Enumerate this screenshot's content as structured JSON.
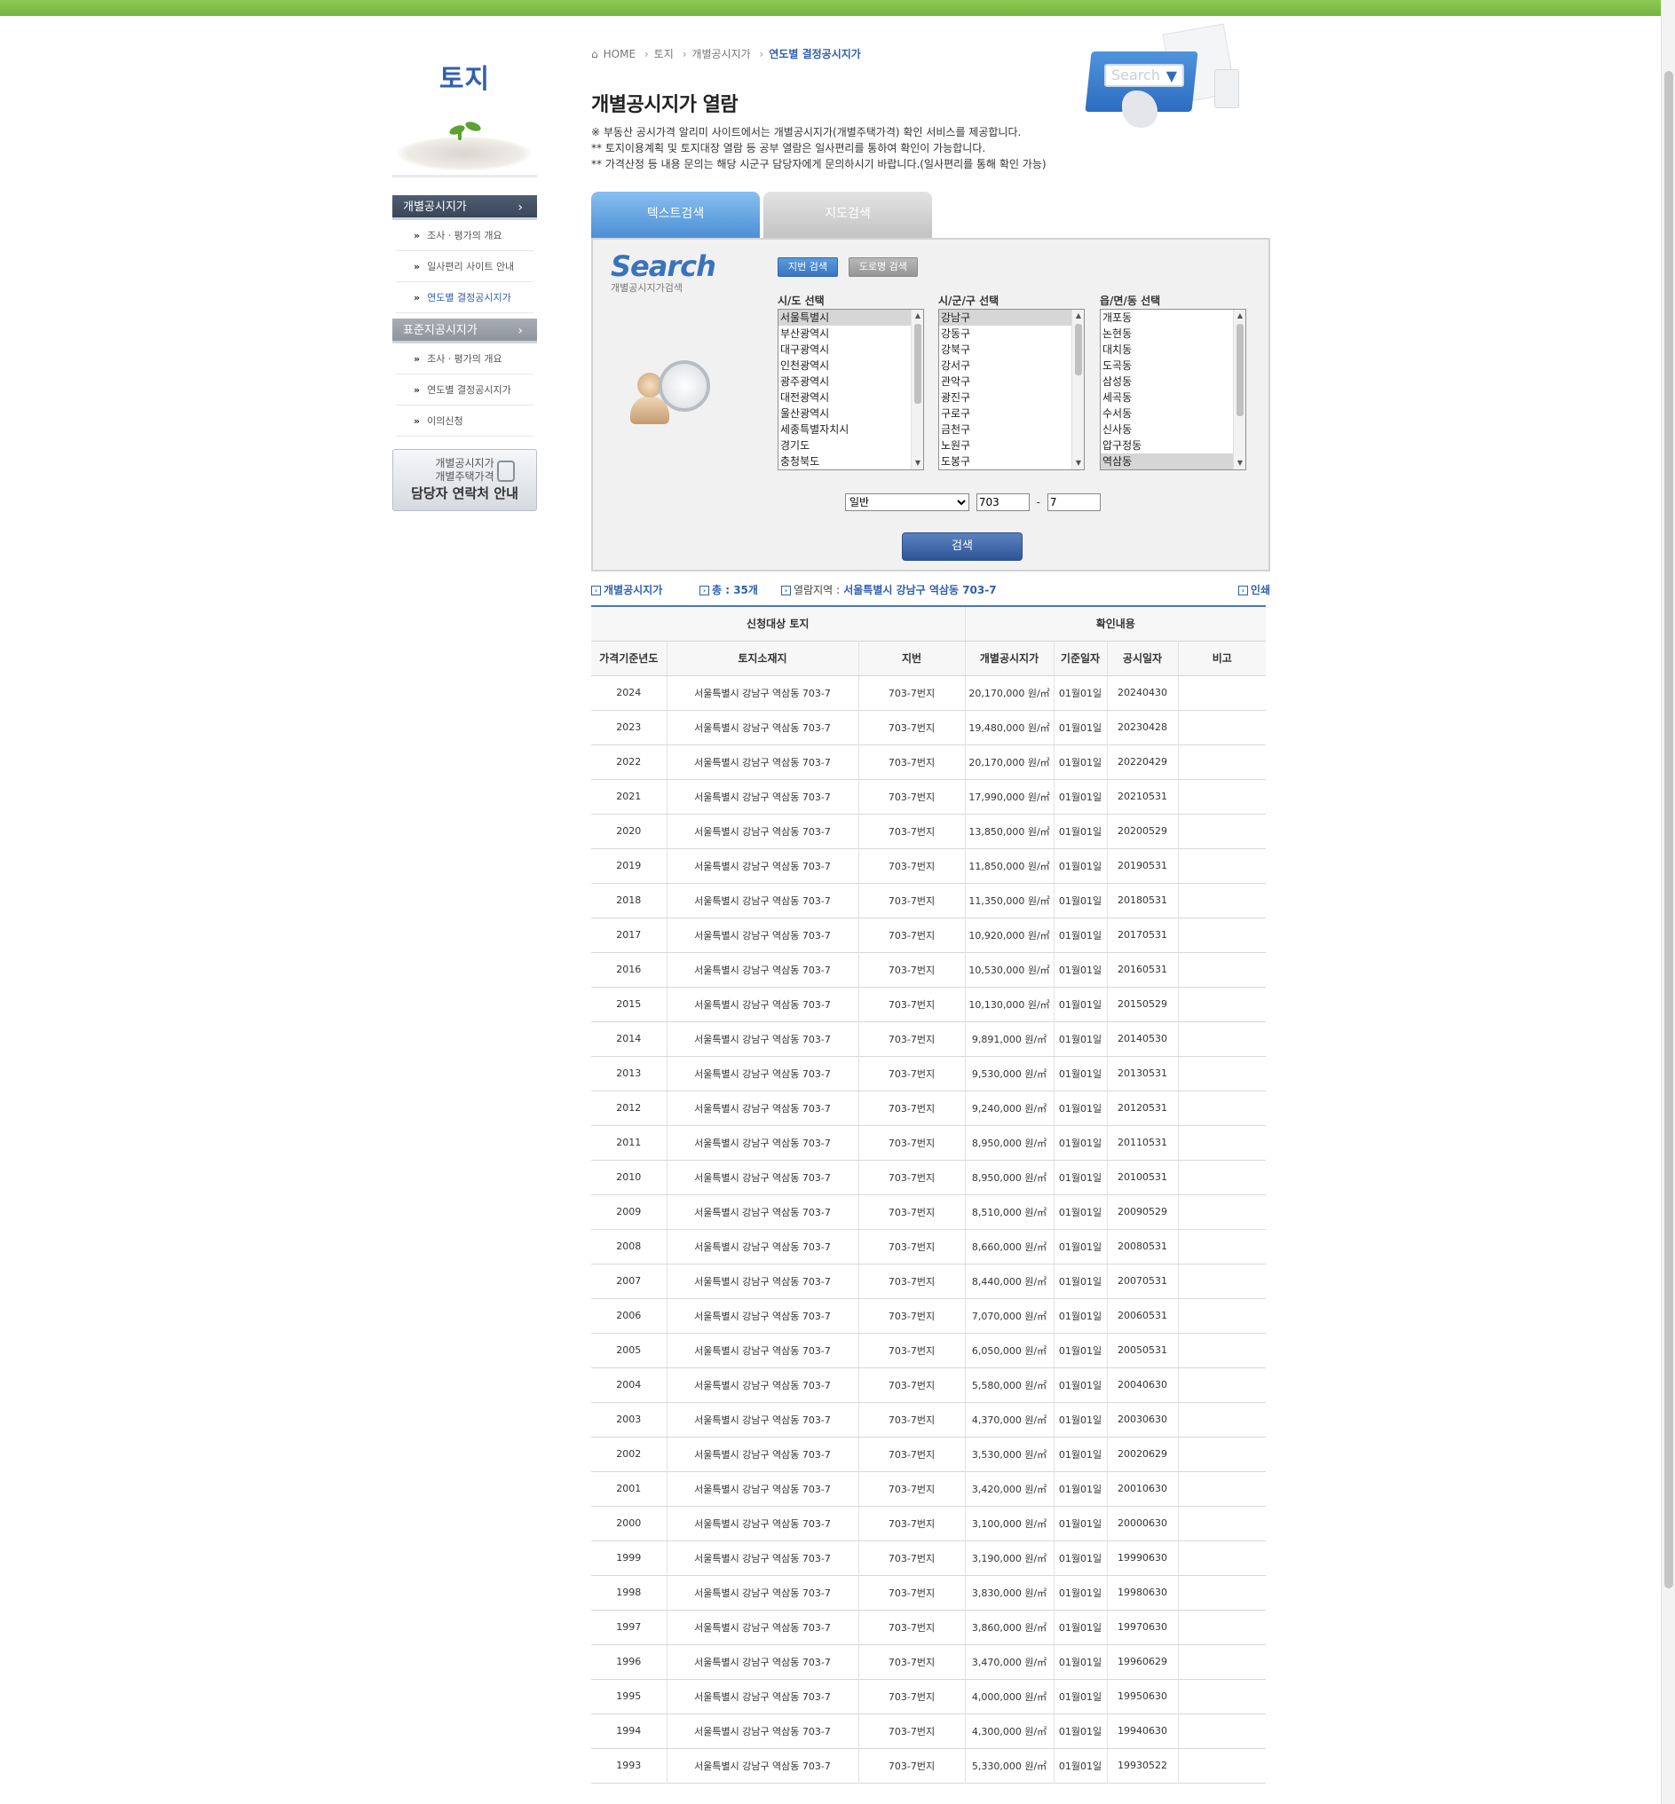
{
  "nav": {
    "title": "토지",
    "menu1_head": "개별공시지가",
    "menu1_items": [
      "조사ㆍ평가의 개요",
      "일사편리 사이트 안내",
      "연도별 결정공시지가"
    ],
    "menu2_head": "표준지공시지가",
    "menu2_items": [
      "조사ㆍ평가의 개요",
      "연도별 결정공시지가",
      "이의신청"
    ],
    "contact_line1": "개별공시지가",
    "contact_line2": "개별주택가격",
    "contact_line3": "담당자 연락처 안내"
  },
  "breadcrumb": [
    "HOME",
    "토지",
    "개별공시지가",
    "연도별 결정공시지가"
  ],
  "header": {
    "search_watermark": "Search"
  },
  "page": {
    "title": "개별공시지가 열람",
    "notes": [
      "※ 부동산 공시가격 알리미 사이트에서는 개별공시지가(개별주택가격) 확인 서비스를 제공합니다.",
      "** 토지이용계획 및 토지대장 열람 등 공부 열람은 일사편리를 통하여 확인이 가능합니다.",
      "** 가격산정 등 내용 문의는 해당 시군구 담당자에게 문의하시기 바랍니다.(일사편리를 통해 확인 가능)"
    ]
  },
  "tabs": {
    "text_search": "텍스트검색",
    "map_search": "지도검색"
  },
  "search": {
    "logo_big": "Search",
    "logo_small": "개별공시지가검색",
    "mode_jibun": "지번 검색",
    "mode_road": "도로명 검색",
    "sido_label": "시/도 선택",
    "sigungu_label": "시/군/구 선택",
    "eupmyeon_label": "읍/면/동 선택",
    "sido_options": [
      "서울특별시",
      "부산광역시",
      "대구광역시",
      "인천광역시",
      "광주광역시",
      "대전광역시",
      "울산광역시",
      "세종특별자치시",
      "경기도",
      "충청북도"
    ],
    "sido_selected": 0,
    "sigungu_options": [
      "강남구",
      "강동구",
      "강북구",
      "강서구",
      "관악구",
      "광진구",
      "구로구",
      "금천구",
      "노원구",
      "도봉구"
    ],
    "sigungu_selected": 0,
    "eupmyeon_options": [
      "개포동",
      "논현동",
      "대치동",
      "도곡동",
      "삼성동",
      "세곡동",
      "수서동",
      "신사동",
      "압구정동",
      "역삼동"
    ],
    "eupmyeon_selected": 9,
    "land_type": "일반",
    "bonbun": "703",
    "bubun": "7",
    "submit": "검색"
  },
  "result": {
    "label": "개별공시지가",
    "total": "총 : 35개",
    "region_label": "열람지역 :",
    "region_value": "서울특별시 강남구 역삼동 703-7",
    "print": "인쇄"
  },
  "table": {
    "group_headers": [
      "신청대상 토지",
      "확인내용"
    ],
    "headers": [
      "가격기준년도",
      "토지소재지",
      "지번",
      "개별공시지가",
      "기준일자",
      "공시일자",
      "비고"
    ],
    "rows": [
      [
        "2024",
        "서울특별시 강남구 역삼동 703-7",
        "703-7번지",
        "20,170,000 원/㎡",
        "01월01일",
        "20240430",
        ""
      ],
      [
        "2023",
        "서울특별시 강남구 역삼동 703-7",
        "703-7번지",
        "19,480,000 원/㎡",
        "01월01일",
        "20230428",
        ""
      ],
      [
        "2022",
        "서울특별시 강남구 역삼동 703-7",
        "703-7번지",
        "20,170,000 원/㎡",
        "01월01일",
        "20220429",
        ""
      ],
      [
        "2021",
        "서울특별시 강남구 역삼동 703-7",
        "703-7번지",
        "17,990,000 원/㎡",
        "01월01일",
        "20210531",
        ""
      ],
      [
        "2020",
        "서울특별시 강남구 역삼동 703-7",
        "703-7번지",
        "13,850,000 원/㎡",
        "01월01일",
        "20200529",
        ""
      ],
      [
        "2019",
        "서울특별시 강남구 역삼동 703-7",
        "703-7번지",
        "11,850,000 원/㎡",
        "01월01일",
        "20190531",
        ""
      ],
      [
        "2018",
        "서울특별시 강남구 역삼동 703-7",
        "703-7번지",
        "11,350,000 원/㎡",
        "01월01일",
        "20180531",
        ""
      ],
      [
        "2017",
        "서울특별시 강남구 역삼동 703-7",
        "703-7번지",
        "10,920,000 원/㎡",
        "01월01일",
        "20170531",
        ""
      ],
      [
        "2016",
        "서울특별시 강남구 역삼동 703-7",
        "703-7번지",
        "10,530,000 원/㎡",
        "01월01일",
        "20160531",
        ""
      ],
      [
        "2015",
        "서울특별시 강남구 역삼동 703-7",
        "703-7번지",
        "10,130,000 원/㎡",
        "01월01일",
        "20150529",
        ""
      ],
      [
        "2014",
        "서울특별시 강남구 역삼동 703-7",
        "703-7번지",
        "9,891,000 원/㎡",
        "01월01일",
        "20140530",
        ""
      ],
      [
        "2013",
        "서울특별시 강남구 역삼동 703-7",
        "703-7번지",
        "9,530,000 원/㎡",
        "01월01일",
        "20130531",
        ""
      ],
      [
        "2012",
        "서울특별시 강남구 역삼동 703-7",
        "703-7번지",
        "9,240,000 원/㎡",
        "01월01일",
        "20120531",
        ""
      ],
      [
        "2011",
        "서울특별시 강남구 역삼동 703-7",
        "703-7번지",
        "8,950,000 원/㎡",
        "01월01일",
        "20110531",
        ""
      ],
      [
        "2010",
        "서울특별시 강남구 역삼동 703-7",
        "703-7번지",
        "8,950,000 원/㎡",
        "01월01일",
        "20100531",
        ""
      ],
      [
        "2009",
        "서울특별시 강남구 역삼동 703-7",
        "703-7번지",
        "8,510,000 원/㎡",
        "01월01일",
        "20090529",
        ""
      ],
      [
        "2008",
        "서울특별시 강남구 역삼동 703-7",
        "703-7번지",
        "8,660,000 원/㎡",
        "01월01일",
        "20080531",
        ""
      ],
      [
        "2007",
        "서울특별시 강남구 역삼동 703-7",
        "703-7번지",
        "8,440,000 원/㎡",
        "01월01일",
        "20070531",
        ""
      ],
      [
        "2006",
        "서울특별시 강남구 역삼동 703-7",
        "703-7번지",
        "7,070,000 원/㎡",
        "01월01일",
        "20060531",
        ""
      ],
      [
        "2005",
        "서울특별시 강남구 역삼동 703-7",
        "703-7번지",
        "6,050,000 원/㎡",
        "01월01일",
        "20050531",
        ""
      ],
      [
        "2004",
        "서울특별시 강남구 역삼동 703-7",
        "703-7번지",
        "5,580,000 원/㎡",
        "01월01일",
        "20040630",
        ""
      ],
      [
        "2003",
        "서울특별시 강남구 역삼동 703-7",
        "703-7번지",
        "4,370,000 원/㎡",
        "01월01일",
        "20030630",
        ""
      ],
      [
        "2002",
        "서울특별시 강남구 역삼동 703-7",
        "703-7번지",
        "3,530,000 원/㎡",
        "01월01일",
        "20020629",
        ""
      ],
      [
        "2001",
        "서울특별시 강남구 역삼동 703-7",
        "703-7번지",
        "3,420,000 원/㎡",
        "01월01일",
        "20010630",
        ""
      ],
      [
        "2000",
        "서울특별시 강남구 역삼동 703-7",
        "703-7번지",
        "3,100,000 원/㎡",
        "01월01일",
        "20000630",
        ""
      ],
      [
        "1999",
        "서울특별시 강남구 역삼동 703-7",
        "703-7번지",
        "3,190,000 원/㎡",
        "01월01일",
        "19990630",
        ""
      ],
      [
        "1998",
        "서울특별시 강남구 역삼동 703-7",
        "703-7번지",
        "3,830,000 원/㎡",
        "01월01일",
        "19980630",
        ""
      ],
      [
        "1997",
        "서울특별시 강남구 역삼동 703-7",
        "703-7번지",
        "3,860,000 원/㎡",
        "01월01일",
        "19970630",
        ""
      ],
      [
        "1996",
        "서울특별시 강남구 역삼동 703-7",
        "703-7번지",
        "3,470,000 원/㎡",
        "01월01일",
        "19960629",
        ""
      ],
      [
        "1995",
        "서울특별시 강남구 역삼동 703-7",
        "703-7번지",
        "4,000,000 원/㎡",
        "01월01일",
        "19950630",
        ""
      ],
      [
        "1994",
        "서울특별시 강남구 역삼동 703-7",
        "703-7번지",
        "4,300,000 원/㎡",
        "01월01일",
        "19940630",
        ""
      ],
      [
        "1993",
        "서울특별시 강남구 역삼동 703-7",
        "703-7번지",
        "5,330,000 원/㎡",
        "01월01일",
        "19930522",
        ""
      ]
    ]
  },
  "colors": {
    "accent": "#2f5fb0",
    "top_bar": "#7cbd45",
    "table_border": "#4a76c0"
  }
}
